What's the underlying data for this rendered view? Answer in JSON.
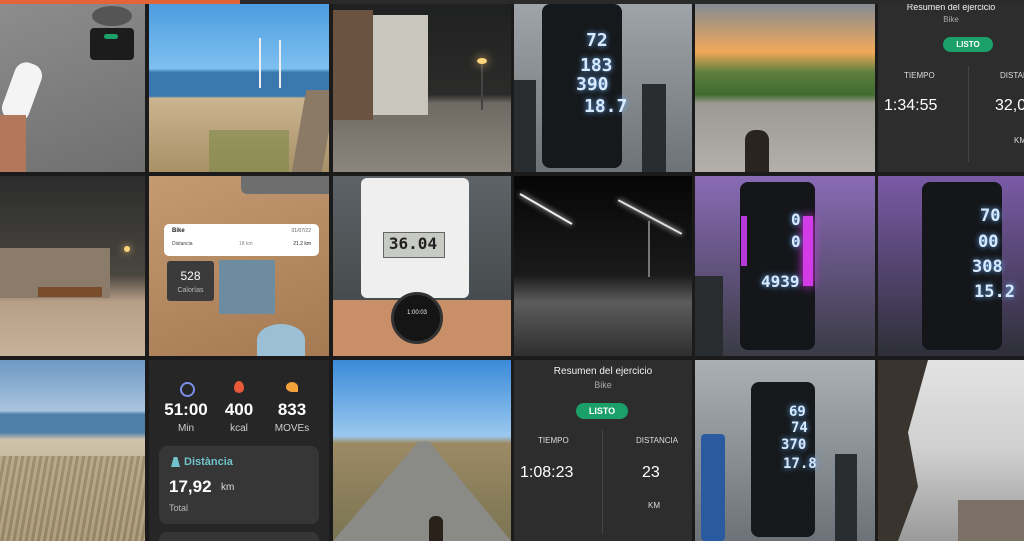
{
  "progress": {
    "fraction": 0.234
  },
  "tiles": {
    "summary_top": {
      "title": "Resumen del ejercicio",
      "subtitle": "Bike",
      "button": "LISTO",
      "time_label": "TIEMPO",
      "time_value": "1:34:55",
      "distance_label": "DISTAN",
      "distance_value": "32,0",
      "distance_unit": "KM"
    },
    "summary_bottom": {
      "title": "Resumen del ejercicio",
      "subtitle": "Bike",
      "button": "LISTO",
      "time_label": "TIEMPO",
      "time_value": "1:08:23",
      "distance_label": "DISTANCIA",
      "distance_value": "23",
      "distance_unit": "KM"
    },
    "bike_machine_1": {
      "v1": "72",
      "v2": "183",
      "v3": "390",
      "v4": "18.7"
    },
    "bike_machine_2": {
      "v1": "0",
      "v2": "0",
      "v3": "4939"
    },
    "bike_machine_3": {
      "v1": "70",
      "v2": "00",
      "v3": "308",
      "v4": "15.2"
    },
    "bike_machine_4": {
      "v1": "69",
      "v2": "74",
      "v3": "370",
      "v4": "17.8"
    },
    "odometer": {
      "value": "36.04"
    },
    "watch_top": {
      "value": "1:00:03"
    },
    "app_card": {
      "title": "Bike",
      "date": "01/07/22",
      "distance_label": "Distancia",
      "distance_mid": "18 km",
      "distance_value": "21.2 km",
      "calories_value": "528",
      "calories_label": "Calorías"
    },
    "stats": {
      "min_value": "51:00",
      "min_label": "Min",
      "kcal_value": "400",
      "kcal_label": "kcal",
      "moves_value": "833",
      "moves_label": "MOVEs",
      "distance_title": "Distància",
      "distance_value": "17,92",
      "distance_unit": "km",
      "distance_sub": "Total"
    }
  }
}
